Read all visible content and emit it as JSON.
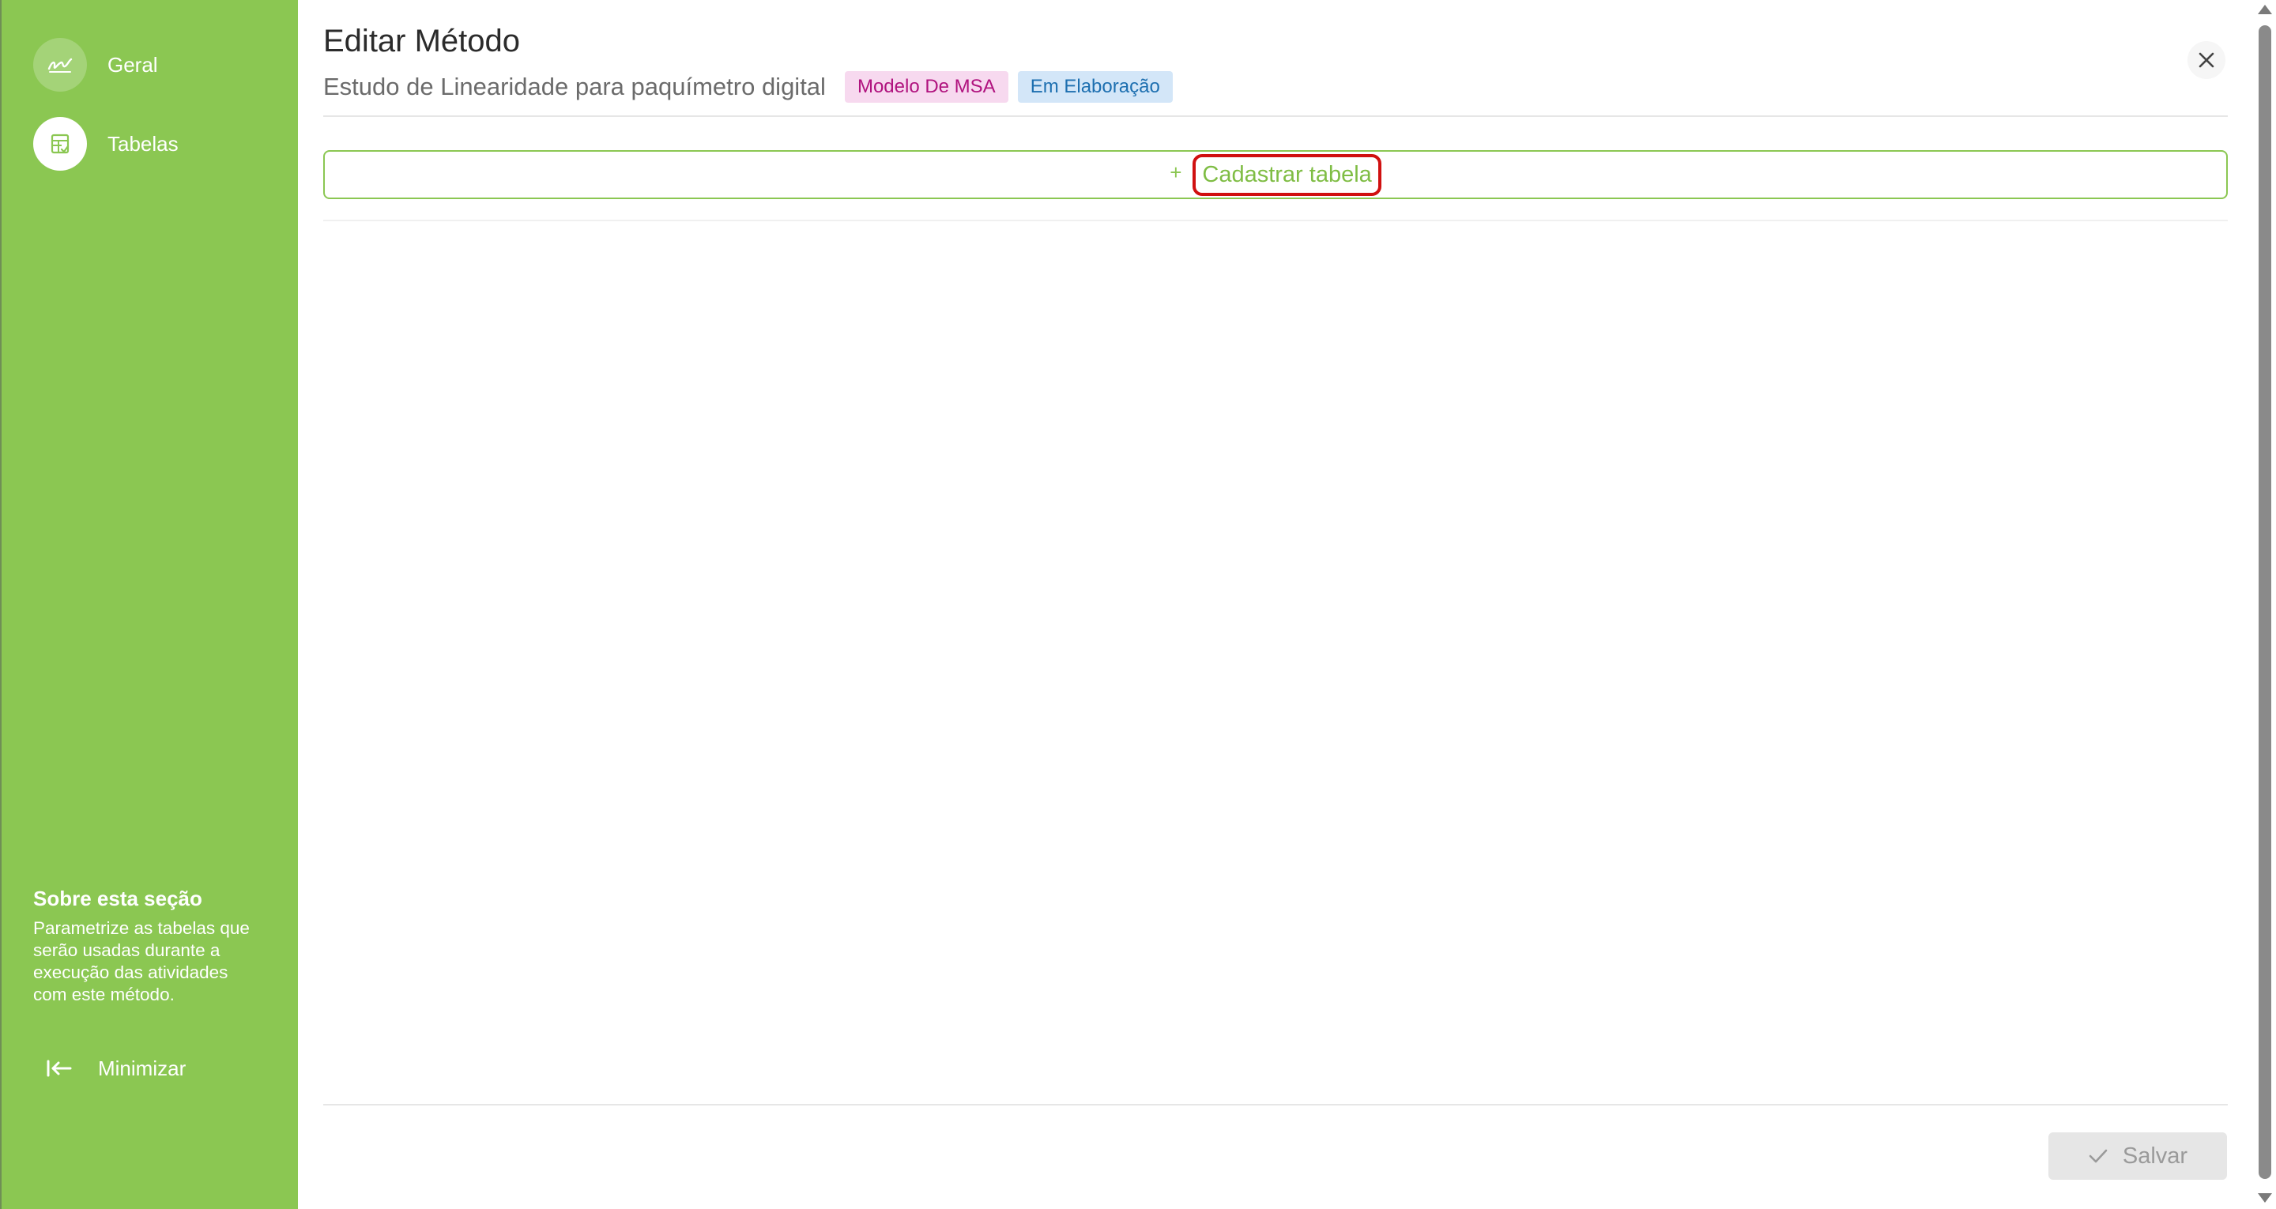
{
  "sidebar": {
    "items": [
      {
        "label": "Geral",
        "icon": "signature-icon",
        "active": false
      },
      {
        "label": "Tabelas",
        "icon": "table-icon",
        "active": true
      }
    ],
    "about_title": "Sobre esta seção",
    "about_text": "Parametrize as tabelas que serão usadas durante a execução das atividades com este método.",
    "minimize_label": "Minimizar"
  },
  "header": {
    "title": "Editar Método",
    "subtitle": "Estudo de Linearidade para paquímetro digital",
    "badges": [
      {
        "label": "Modelo De MSA",
        "color": "#b0127e",
        "bg": "#f7d9ef"
      },
      {
        "label": "Em Elaboração",
        "color": "#1d6fb0",
        "bg": "#d3e6f8"
      }
    ]
  },
  "main": {
    "add_table_label": "Cadastrar tabela",
    "add_icon": "plus-icon"
  },
  "footer": {
    "save_label": "Salvar",
    "save_icon": "check-icon"
  },
  "colors": {
    "accent": "#8bc752",
    "highlight": "#d01010"
  }
}
